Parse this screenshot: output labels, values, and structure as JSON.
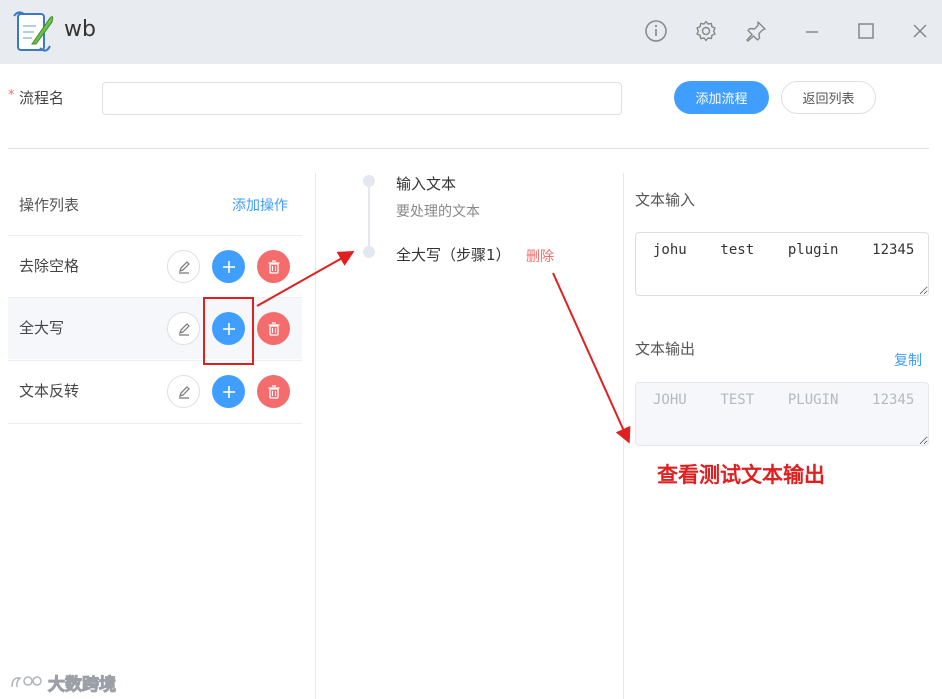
{
  "window": {
    "title": "wb",
    "controls": [
      "info-icon",
      "gear-icon",
      "pin-icon",
      "minimize-icon",
      "maximize-icon",
      "close-icon"
    ]
  },
  "form": {
    "required_mark": "*",
    "flow_name_label": "流程名",
    "flow_name_value": "",
    "add_flow_label": "添加流程",
    "back_list_label": "返回列表"
  },
  "operations": {
    "title": "操作列表",
    "add_label": "添加操作",
    "items": [
      {
        "label": "去除空格"
      },
      {
        "label": "全大写"
      },
      {
        "label": "文本反转"
      }
    ]
  },
  "timeline": {
    "steps": [
      {
        "title": "输入文本",
        "subtitle": "要处理的文本"
      },
      {
        "title": "全大写（步骤1）",
        "action": "删除"
      }
    ]
  },
  "panel": {
    "input_label": "文本输入",
    "input_value": "johu    test    plugin    12345",
    "output_label": "文本输出",
    "copy_label": "复制",
    "output_value": "JOHU    TEST    PLUGIN    12345"
  },
  "annotation": {
    "text": "查看测试文本输出",
    "color": "#e02020"
  },
  "watermark": {
    "text": "大数跨境"
  },
  "colors": {
    "primary": "#409eff",
    "danger": "#f56c6c",
    "titlebar": "#e8ebef"
  }
}
